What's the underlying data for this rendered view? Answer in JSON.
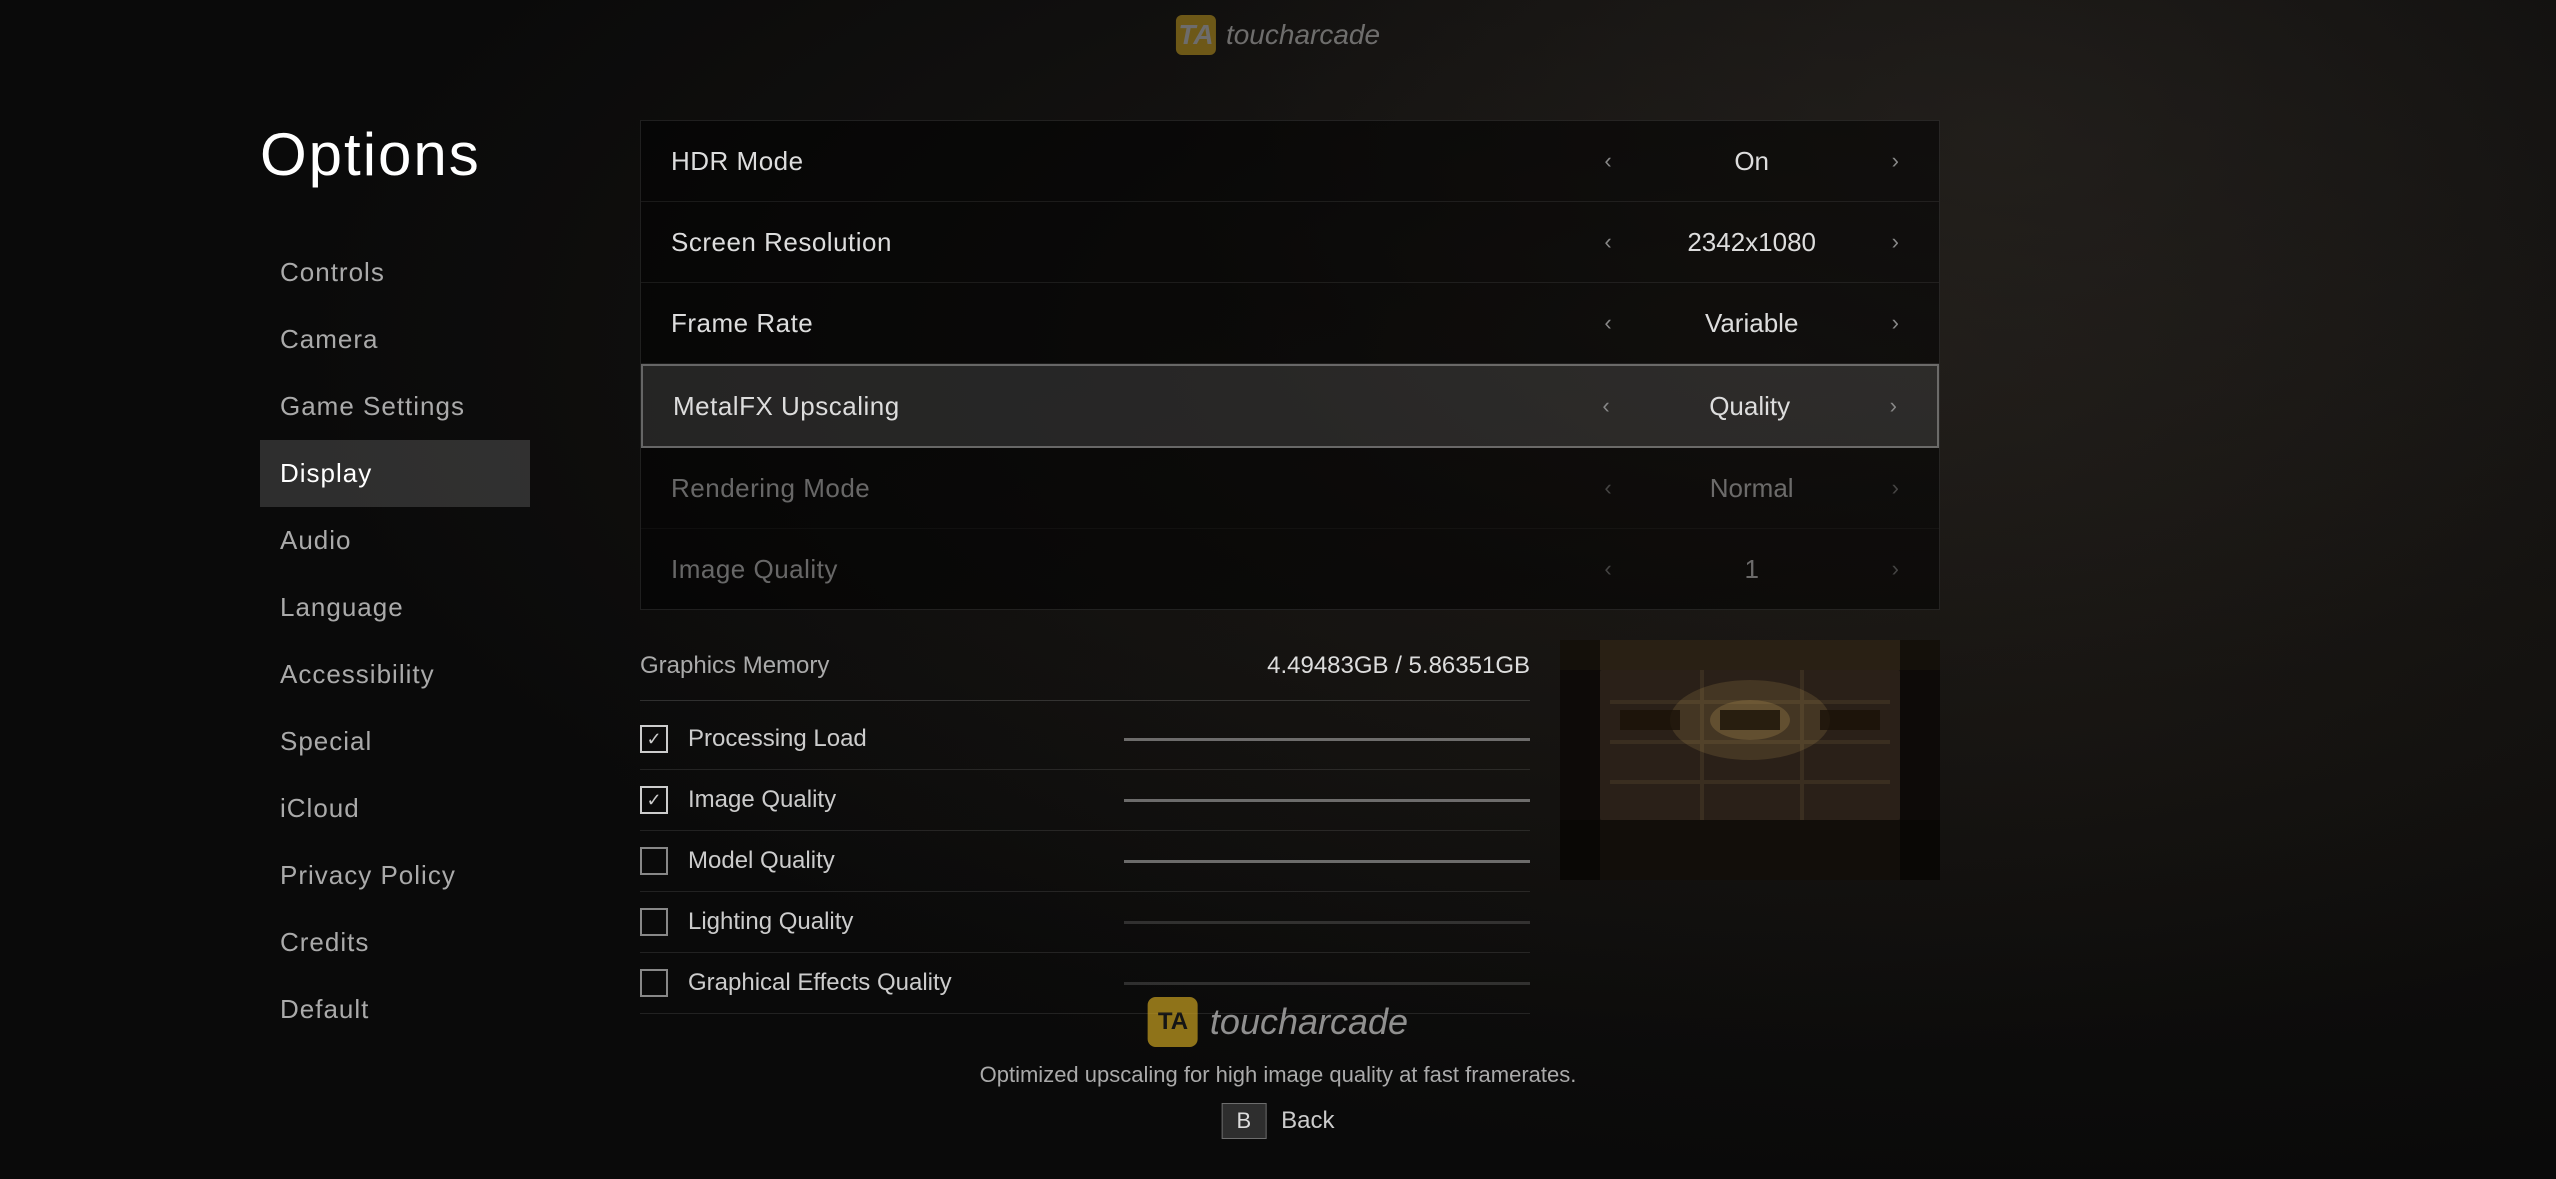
{
  "page": {
    "title": "Options"
  },
  "watermark": {
    "icon": "TA",
    "brand": "toucharcade"
  },
  "sidebar": {
    "items": [
      {
        "id": "controls",
        "label": "Controls",
        "active": false
      },
      {
        "id": "camera",
        "label": "Camera",
        "active": false
      },
      {
        "id": "game-settings",
        "label": "Game Settings",
        "active": false
      },
      {
        "id": "display",
        "label": "Display",
        "active": true
      },
      {
        "id": "audio",
        "label": "Audio",
        "active": false
      },
      {
        "id": "language",
        "label": "Language",
        "active": false
      },
      {
        "id": "accessibility",
        "label": "Accessibility",
        "active": false
      },
      {
        "id": "special",
        "label": "Special",
        "active": false
      },
      {
        "id": "icloud",
        "label": "iCloud",
        "active": false
      },
      {
        "id": "privacy-policy",
        "label": "Privacy Policy",
        "active": false
      },
      {
        "id": "credits",
        "label": "Credits",
        "active": false
      },
      {
        "id": "default",
        "label": "Default",
        "active": false
      }
    ]
  },
  "settings": {
    "rows": [
      {
        "id": "hdr-mode",
        "label": "HDR Mode",
        "value": "On",
        "highlighted": false,
        "dimmed": false
      },
      {
        "id": "screen-resolution",
        "label": "Screen Resolution",
        "value": "2342x1080",
        "highlighted": false,
        "dimmed": false
      },
      {
        "id": "frame-rate",
        "label": "Frame Rate",
        "value": "Variable",
        "highlighted": false,
        "dimmed": false
      },
      {
        "id": "metalfx-upscaling",
        "label": "MetalFX Upscaling",
        "value": "Quality",
        "highlighted": true,
        "dimmed": false
      },
      {
        "id": "rendering-mode",
        "label": "Rendering Mode",
        "value": "Normal",
        "highlighted": false,
        "dimmed": true
      },
      {
        "id": "image-quality",
        "label": "Image Quality",
        "value": "1",
        "highlighted": false,
        "dimmed": true
      }
    ]
  },
  "graphics_overlay": {
    "header_label": "Graphics Memory",
    "header_value": "4.49483GB  /  5.86351GB",
    "items": [
      {
        "id": "processing-load",
        "label": "Processing Load",
        "checked": true,
        "bar_filled": true
      },
      {
        "id": "image-quality-check",
        "label": "Image Quality",
        "checked": true,
        "bar_filled": true
      },
      {
        "id": "model-quality",
        "label": "Model Quality",
        "checked": false,
        "bar_filled": true
      },
      {
        "id": "lighting-quality",
        "label": "Lighting Quality",
        "checked": false,
        "bar_filled": false
      },
      {
        "id": "graphical-effects-quality",
        "label": "Graphical Effects Quality",
        "checked": false,
        "bar_filled": false
      }
    ]
  },
  "footer": {
    "description": "Optimized upscaling for high image quality at fast framerates.",
    "nav_key": "B",
    "nav_label": "Back",
    "brand": "toucharcade"
  }
}
